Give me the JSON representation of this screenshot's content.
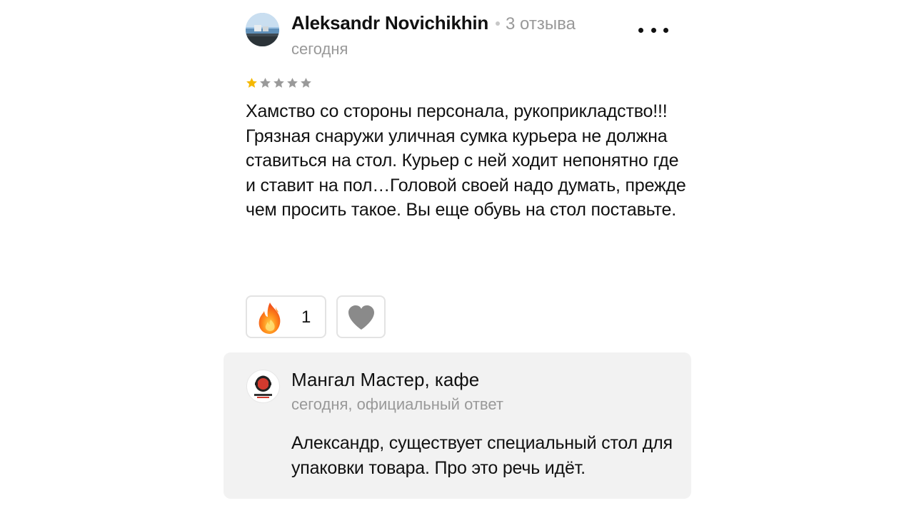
{
  "review": {
    "author_name": "Aleksandr Novichikhin",
    "author_reviews": "3 отзыва",
    "date": "сегодня",
    "rating": 1,
    "rating_max": 5,
    "text_lines": [
      "Хамство со стороны персонала, рукоприкладство!!!",
      "Грязная снаружи уличная сумка курьера не должна ставиться на стол. Курьер с ней ходит непонятно где и ставит на пол…Головой своей надо думать, прежде чем просить такое. Вы еще обувь на стол поставьте."
    ],
    "reactions": {
      "fire_count": "1"
    }
  },
  "owner_reply": {
    "name": "Мангал Мастер, кафе",
    "meta": "сегодня, официальный ответ",
    "text": "Александр, существует специальный стол для упаковки товара. Про это речь идёт."
  },
  "colors": {
    "star_filled": "#f5b800",
    "star_empty": "#9a9a9a",
    "reply_background": "#f2f2f2",
    "secondary_text": "#999999"
  }
}
